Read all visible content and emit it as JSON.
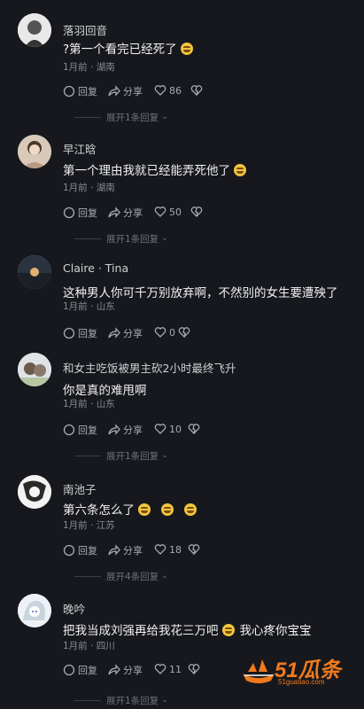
{
  "comments": [
    {
      "name": "落羽回音",
      "text": "?第一个看完已经死了",
      "meta": "1月前 · 湖南",
      "reply": "回复",
      "share": "分享",
      "likes": "86",
      "expand": "展开1条回复"
    },
    {
      "name": "早江晗",
      "text": "第一个理由我就已经能弄死他了",
      "meta": "1月前 · 湖南",
      "reply": "回复",
      "share": "分享",
      "likes": "50",
      "expand": "展开1条回复"
    },
    {
      "name": "Claire · Tina",
      "text": "这种男人你可千万别放弃啊，不然别的女生要遭殃了",
      "meta": "1月前 · 山东",
      "reply": "回复",
      "share": "分享",
      "likes": "0",
      "expand": ""
    },
    {
      "name": "和女主吃饭被男主砍2小时最终飞升",
      "text": "你是真的难甩啊",
      "meta": "1月前 · 山东",
      "reply": "回复",
      "share": "分享",
      "likes": "10",
      "expand": "展开1条回复"
    },
    {
      "name": "南池子",
      "text": "第六条怎么了",
      "meta": "1月前 · 江苏",
      "reply": "回复",
      "share": "分享",
      "likes": "18",
      "expand": "展开4条回复"
    },
    {
      "name": "晚吟",
      "text": "把我当成刘强再给我花三万吧",
      "text2": "我心疼你宝宝",
      "meta": "1月前 · 四川",
      "reply": "回复",
      "share": "分享",
      "likes": "11",
      "expand": "展开1条回复"
    }
  ],
  "watermark": {
    "brand": "51瓜条",
    "url": "51guatiao.com"
  },
  "colors": {
    "background": "#16181d",
    "emoji": "#f2c53d",
    "brand": "#f07a1c"
  }
}
